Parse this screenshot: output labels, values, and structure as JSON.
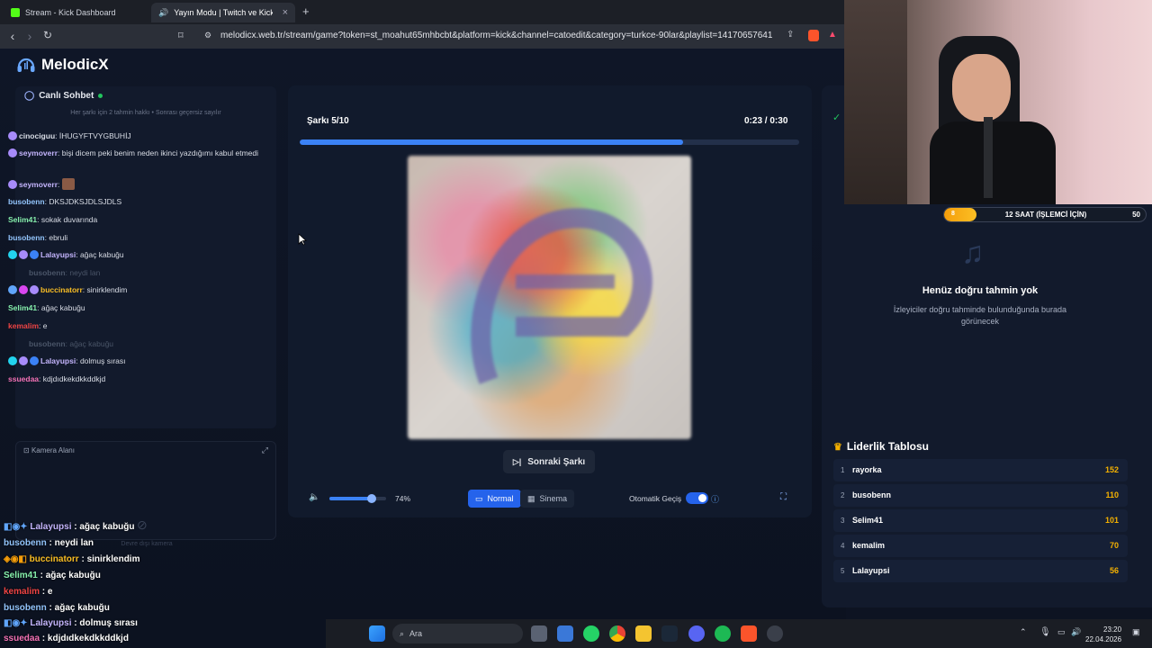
{
  "browser": {
    "tabs": [
      {
        "label": "Stream - Kick Dashboard",
        "active": false
      },
      {
        "label": "Yayın Modu | Twitch ve Kick iç",
        "active": true
      }
    ],
    "url": "melodicx.web.tr/stream/game?token=st_moahut65mhbcbt&platform=kick&channel=catoedit&category=turkce-90lar&playlist=14170657641"
  },
  "app": {
    "name": "MelodicX"
  },
  "chat": {
    "title": "Canlı Sohbet",
    "subtitle": "Her şarkı için 2 tahmin hakkı • Sonrası geçersiz sayılır",
    "messages": [
      {
        "user": "cinociguu",
        "text": "İHUGYFTVYGBUHİJ",
        "color": "#ffffff"
      },
      {
        "user": "seymoverr",
        "text": "bişi dicem peki benim neden ikinci yazdığımı kabul etmedi",
        "color": "#c4b5fd"
      },
      {
        "user": "seymoverr",
        "text": "",
        "color": "#c4b5fd"
      },
      {
        "user": "busobenn",
        "text": "DKSJDKSJDLSJDLS",
        "color": "#93c5fd"
      },
      {
        "user": "Selim41",
        "text": "sokak duvarında",
        "color": "#86efac"
      },
      {
        "user": "busobenn",
        "text": "ebruli",
        "color": "#93c5fd"
      },
      {
        "user": "Lalayupsi",
        "text": "ağaç kabuğu",
        "color": "#c4b5fd"
      },
      {
        "user": "busobenn",
        "text": "neydi lan",
        "color": "#4a5568"
      },
      {
        "user": "buccinatorr",
        "text": "sinirklendim",
        "color": "#fbbf24"
      },
      {
        "user": "Selim41",
        "text": "ağaç kabuğu",
        "color": "#86efac"
      },
      {
        "user": "kemalim",
        "text": "e",
        "color": "#ef4444"
      },
      {
        "user": "busobenn",
        "text": "ağaç kabuğu",
        "color": "#4a5568"
      },
      {
        "user": "Lalayupsi",
        "text": "dolmuş sırası",
        "color": "#c4b5fd"
      },
      {
        "user": "ssuedaa",
        "text": "kdjdıdkekdkkddkjd",
        "color": "#f472b6"
      }
    ]
  },
  "camera": {
    "title": "Kamera Alanı",
    "status": "Devre dışı kamera"
  },
  "overlay_chat": [
    {
      "user": "Lalayupsi",
      "text": "ağaç kabuğu",
      "color": "#c4b5fd"
    },
    {
      "user": "busobenn",
      "text": "neydi lan",
      "color": "#93c5fd"
    },
    {
      "user": "buccinatorr",
      "text": "sinirklendim",
      "color": "#fbbf24"
    },
    {
      "user": "Selim41",
      "text": "ağaç kabuğu",
      "color": "#86efac"
    },
    {
      "user": "kemalim",
      "text": "e",
      "color": "#ef4444"
    },
    {
      "user": "busobenn",
      "text": "ağaç kabuğu",
      "color": "#93c5fd"
    },
    {
      "user": "Lalayupsi",
      "text": "dolmuş sırası",
      "color": "#c4b5fd"
    },
    {
      "user": "ssuedaa",
      "text": "kdjdıdkekdkkddkjd",
      "color": "#f472b6"
    }
  ],
  "player": {
    "track_counter": "Şarkı 5/10",
    "time_elapsed": "0:23",
    "time_sep": "/",
    "time_total": "0:30",
    "progress_fraction": 0.7667,
    "next_label": "Sonraki Şarkı",
    "volume_label": "74%",
    "volume_fraction": 0.74,
    "mode_normal": "Normal",
    "mode_cinema": "Sinema",
    "auto_label": "Otomatik Geçiş",
    "auto_enabled": true
  },
  "subgoal": {
    "current": "8",
    "label": "12 SAAT (İŞLEMCİ İÇİN)",
    "max": "50",
    "fraction": 0.16
  },
  "guesses": {
    "empty_title": "Henüz doğru tahmin yok",
    "empty_desc": "İzleyiciler doğru tahminde bulunduğunda burada görünecek"
  },
  "leaderboard": {
    "title": "Liderlik Tablosu",
    "rows": [
      {
        "rank": "1",
        "name": "rayorka",
        "score": "152"
      },
      {
        "rank": "2",
        "name": "busobenn",
        "score": "110"
      },
      {
        "rank": "3",
        "name": "Selim41",
        "score": "101"
      },
      {
        "rank": "4",
        "name": "kemalim",
        "score": "70"
      },
      {
        "rank": "5",
        "name": "Lalayupsi",
        "score": "56"
      }
    ]
  },
  "taskbar": {
    "search_label": "Ara",
    "time": "23:20",
    "date": "22.04.2026"
  },
  "colors": {
    "accent": "#3b82f6",
    "gold": "#f5b100",
    "bg": "#0d1322"
  }
}
